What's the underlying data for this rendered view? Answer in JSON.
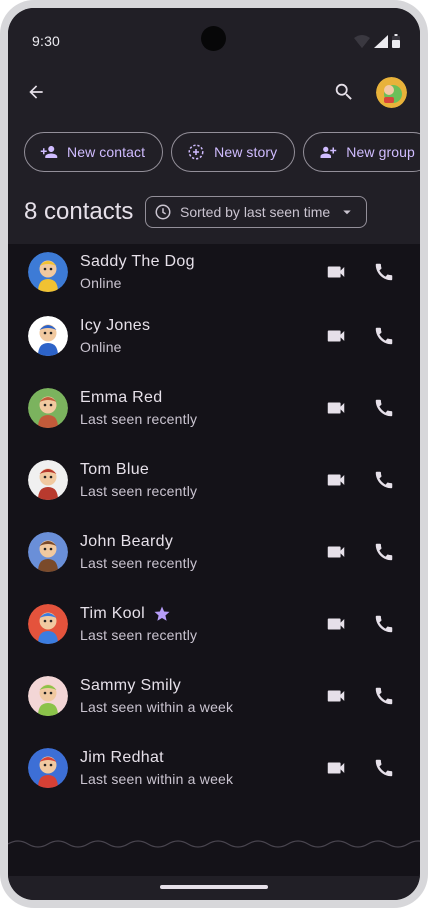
{
  "status_bar": {
    "time": "9:30"
  },
  "app_bar": {
    "back_icon": "arrow-back-icon",
    "search_icon": "search-icon",
    "avatar_colors": [
      "#e8b23a",
      "#6bbf59",
      "#d9453b"
    ]
  },
  "chips": [
    {
      "label": "New contact",
      "icon": "person-add-icon"
    },
    {
      "label": "New story",
      "icon": "story-add-icon"
    },
    {
      "label": "New group",
      "icon": "group-add-icon"
    }
  ],
  "header": {
    "count_label": "8 contacts",
    "sort_label": "Sorted by last seen time",
    "sort_icon": "clock-icon",
    "dropdown_icon": "caret-down-icon"
  },
  "contacts": [
    {
      "name": "Saddy The Dog",
      "status": "Online",
      "favorite": false,
      "bg": "#3d7bd6",
      "fg": "#f1c232"
    },
    {
      "name": "Icy Jones",
      "status": "Online",
      "favorite": false,
      "bg": "#ffffff",
      "fg": "#2d63c8"
    },
    {
      "name": "Emma Red",
      "status": "Last seen recently",
      "favorite": false,
      "bg": "#7bb35e",
      "fg": "#c25b3a"
    },
    {
      "name": "Tom Blue",
      "status": "Last seen recently",
      "favorite": false,
      "bg": "#f0f0f0",
      "fg": "#b83a2e"
    },
    {
      "name": "John Beardy",
      "status": "Last seen recently",
      "favorite": false,
      "bg": "#6a8fd8",
      "fg": "#7a4a2a"
    },
    {
      "name": "Tim Kool",
      "status": "Last seen recently",
      "favorite": true,
      "bg": "#e4533c",
      "fg": "#3b7de0"
    },
    {
      "name": "Sammy Smily",
      "status": "Last seen within a week",
      "favorite": false,
      "bg": "#f3d6d6",
      "fg": "#8bc34a"
    },
    {
      "name": "Jim Redhat",
      "status": "Last seen within a week",
      "favorite": false,
      "bg": "#3d6fd6",
      "fg": "#d64035"
    }
  ],
  "colors": {
    "accent": "#d0bcff",
    "background": "#141218",
    "surface": "#211f26",
    "on_surface": "#e6e0e9",
    "star": "#b69df8"
  }
}
